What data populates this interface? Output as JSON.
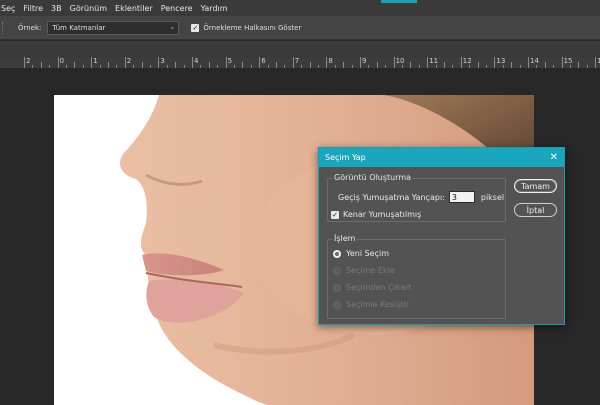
{
  "menubar": {
    "items": [
      "Seç",
      "Filtre",
      "3B",
      "Görünüm",
      "Eklentiler",
      "Pencere",
      "Yardım"
    ]
  },
  "optionsbar": {
    "sample_label": "Örnek:",
    "sample_value": "Tüm Katmanlar",
    "show_ring_label": "Örnekleme Halkasını Göster",
    "show_ring_checked": true
  },
  "ruler": {
    "labels": [
      "2",
      "0",
      "1",
      "2",
      "3",
      "4",
      "5",
      "6",
      "7",
      "8",
      "9",
      "10",
      "11",
      "12",
      "13",
      "14",
      "15",
      "16"
    ]
  },
  "dialog": {
    "title": "Seçim Yap",
    "render_group": {
      "legend": "Görüntü Oluşturma",
      "feather_label": "Geçiş Yumuşatma Yançapı:",
      "feather_value": "3",
      "feather_unit": "piksel",
      "antialias_label": "Kenar Yumuşatılmış",
      "antialias_checked": true
    },
    "operation_group": {
      "legend": "İşlem",
      "options": [
        {
          "label": "Yeni Seçim",
          "selected": true,
          "enabled": true
        },
        {
          "label": "Seçime Ekle",
          "selected": false,
          "enabled": false
        },
        {
          "label": "Seçimden Çıkart",
          "selected": false,
          "enabled": false
        },
        {
          "label": "Seçimle Kesiştir",
          "selected": false,
          "enabled": false
        }
      ]
    },
    "ok_label": "Tamam",
    "cancel_label": "İptal"
  }
}
